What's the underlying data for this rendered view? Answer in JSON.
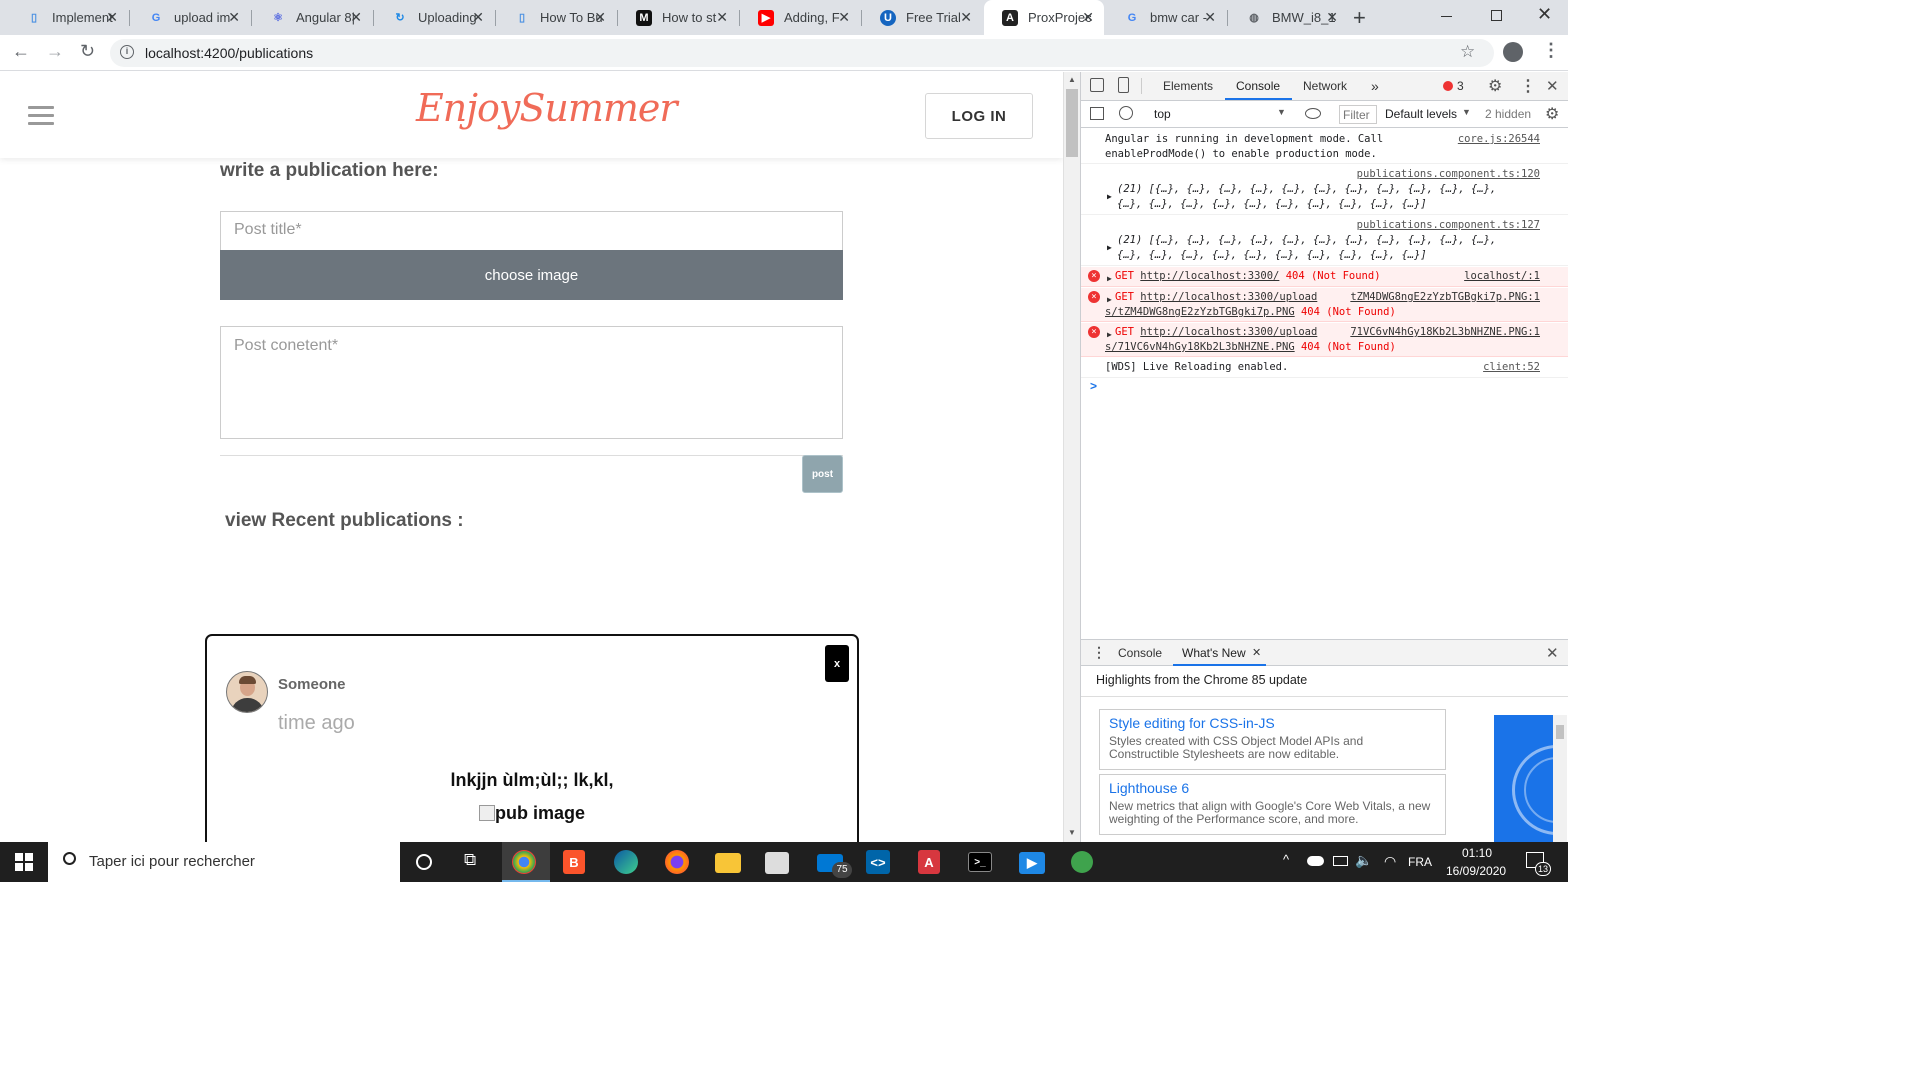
{
  "browser": {
    "tabs": [
      {
        "title": "Implement",
        "icon": "document-icon",
        "color": "#4a90e2"
      },
      {
        "title": "upload im",
        "icon": "google-icon",
        "color": "#4285f4"
      },
      {
        "title": "Angular 8|",
        "icon": "react-icon",
        "color": "#5b6ee1"
      },
      {
        "title": "Uploading",
        "icon": "refresh-logo-icon",
        "color": "#1e88e5"
      },
      {
        "title": "How To Bu",
        "icon": "document-icon",
        "color": "#4a90e2"
      },
      {
        "title": "How to st",
        "icon": "medium-icon",
        "color": "#111111"
      },
      {
        "title": "Adding, F",
        "icon": "youtube-icon",
        "color": "#ff0000"
      },
      {
        "title": "Free Trial",
        "icon": "u-logo-icon",
        "color": "#1565c0"
      },
      {
        "title": "ProxProjec",
        "icon": "angular-icon",
        "color": "#222222",
        "active": true
      },
      {
        "title": "bmw car -",
        "icon": "google-icon",
        "color": "#4285f4"
      },
      {
        "title": "BMW_i8_1",
        "icon": "globe-icon",
        "color": "#5f6368"
      }
    ],
    "url": "localhost:4200/publications"
  },
  "app": {
    "brand": "EnjoySummer",
    "login": "LOG IN",
    "write_title": "write a publication here:",
    "title_placeholder": "Post title*",
    "choose_image": "choose image",
    "content_placeholder": "Post conetent*",
    "post_button": "post",
    "recent_title": "view Recent publications :",
    "card": {
      "close": "x",
      "author": "Someone",
      "time": "time ago",
      "title": "lnkjjn ùlm;ùl;; lk,kl,",
      "image_alt": "pub image"
    }
  },
  "devtools": {
    "tabs": [
      "Elements",
      "Console",
      "Network"
    ],
    "error_count": "3",
    "context": "top",
    "filter": "Filter",
    "levels": "Default levels",
    "hidden": "2 hidden",
    "console": [
      {
        "text": "Angular is running in development mode. Call enableProdMode() to enable production mode.",
        "src": "core.js:26544"
      },
      {
        "src": "publications.component.ts:120",
        "text": "(21) [{…}, {…}, {…}, {…}, {…}, {…}, {…}, {…}, {…}, {…}, {…}, {…}, {…}, {…}, {…}, {…}, {…}, {…}, {…}, {…}, {…}]"
      },
      {
        "src": "publications.component.ts:127",
        "text": "(21) [{…}, {…}, {…}, {…}, {…}, {…}, {…}, {…}, {…}, {…}, {…}, {…}, {…}, {…}, {…}, {…}, {…}, {…}, {…}, {…}, {…}]"
      },
      {
        "error": true,
        "method": "GET",
        "url": "http://localhost:3300/",
        "status": "404 (Not Found)",
        "src": "localhost/:1"
      },
      {
        "error": true,
        "method": "GET",
        "url": "http://localhost:3300/upload",
        "url2": "s/tZM4DWG8ngE2zYzbTGBgki7p.PNG",
        "status": "404 (Not Found)",
        "src": "tZM4DWG8ngE2zYzbTGBgki7p.PNG:1"
      },
      {
        "error": true,
        "method": "GET",
        "url": "http://localhost:3300/upload",
        "url2": "s/71VC6vN4hGy18Kb2L3bNHZNE.PNG",
        "status": "404 (Not Found)",
        "src": "71VC6vN4hGy18Kb2L3bNHZNE.PNG:1"
      },
      {
        "text": "[WDS] Live Reloading enabled.",
        "src": "client:52"
      }
    ],
    "prompt": ">",
    "drawer": {
      "tabs": [
        "Console",
        "What's New"
      ],
      "heading": "Highlights from the Chrome 85 update",
      "items": [
        {
          "title": "Style editing for CSS-in-JS",
          "desc": "Styles created with CSS Object Model APIs and Constructible Stylesheets are now editable."
        },
        {
          "title": "Lighthouse 6",
          "desc": "New metrics that align with Google's Core Web Vitals, a new weighting of the Performance score, and more."
        }
      ]
    }
  },
  "taskbar": {
    "search": "Taper ici pour rechercher",
    "lang": "FRA",
    "time": "01:10",
    "date": "16/09/2020",
    "mail_badge": "75",
    "notif": "13"
  }
}
